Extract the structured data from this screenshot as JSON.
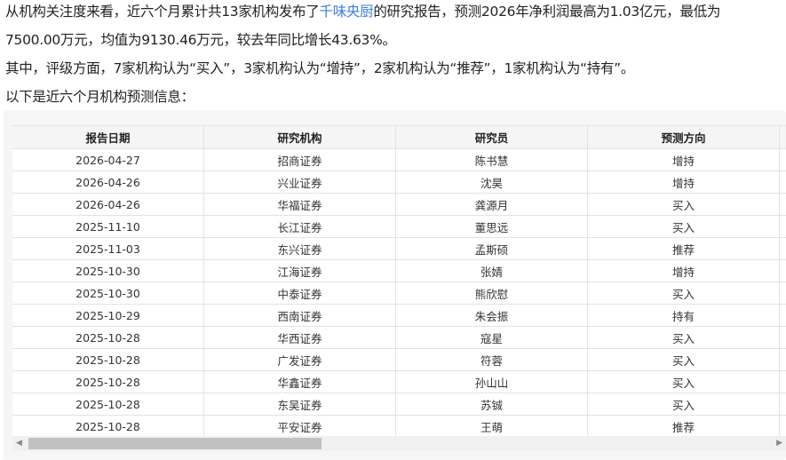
{
  "summary": {
    "line1_a": "从机构关注度来看，近六个月累计共13家机构发布了",
    "company_link": "千味央厨",
    "line1_b": "的研究报告，预测2026年净利润最高为1.03亿元，最低为",
    "line2": "7500.00万元，均值为9130.46万元，较去年同比增长43.63%。",
    "line3": "其中，评级方面，7家机构认为“买入”，3家机构认为“增持”，2家机构认为“推荐”，1家机构认为“持有”。",
    "line4": "以下是近六个月机构预测信息："
  },
  "table": {
    "headers": [
      "报告日期",
      "研究机构",
      "研究员",
      "预测方向"
    ],
    "rows": [
      [
        "2026-04-27",
        "招商证券",
        "陈书慧",
        "增持"
      ],
      [
        "2026-04-26",
        "兴业证券",
        "沈昊",
        "增持"
      ],
      [
        "2026-04-26",
        "华福证券",
        "龚源月",
        "买入"
      ],
      [
        "2025-11-10",
        "长江证券",
        "董思远",
        "买入"
      ],
      [
        "2025-11-03",
        "东兴证券",
        "孟斯硕",
        "推荐"
      ],
      [
        "2025-10-30",
        "江海证券",
        "张婧",
        "增持"
      ],
      [
        "2025-10-30",
        "中泰证券",
        "熊欣慰",
        "买入"
      ],
      [
        "2025-10-29",
        "西南证券",
        "朱会振",
        "持有"
      ],
      [
        "2025-10-28",
        "华西证券",
        "寇星",
        "买入"
      ],
      [
        "2025-10-28",
        "广发证券",
        "符蓉",
        "买入"
      ],
      [
        "2025-10-28",
        "华鑫证券",
        "孙山山",
        "买入"
      ],
      [
        "2025-10-28",
        "东吴证券",
        "苏铖",
        "买入"
      ],
      [
        "2025-10-28",
        "平安证券",
        "王萌",
        "推荐"
      ]
    ]
  }
}
